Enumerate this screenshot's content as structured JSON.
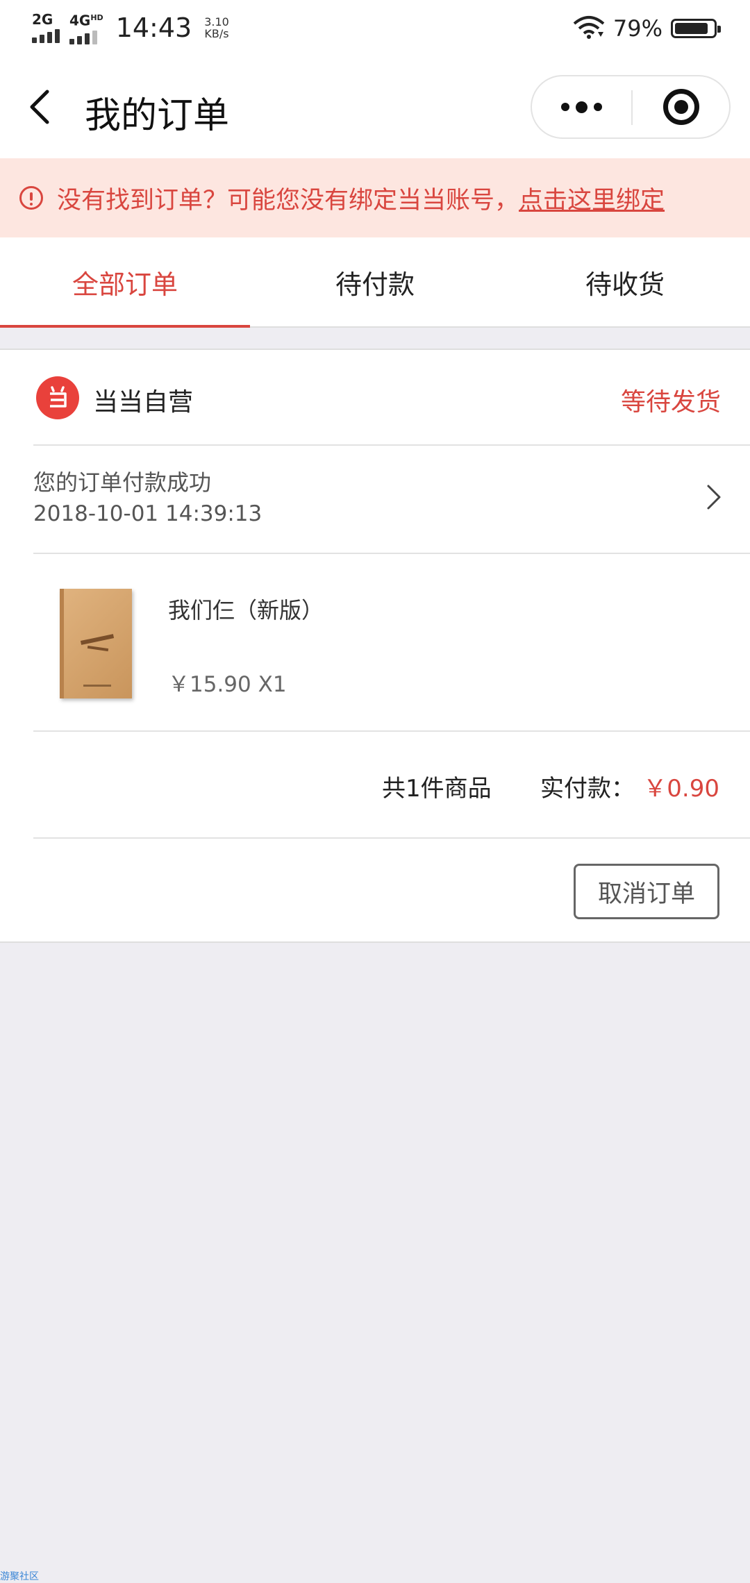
{
  "status_bar": {
    "network_1": "2G",
    "network_2": "4G",
    "network_2_sup": "HD",
    "time": "14:43",
    "speed_value": "3.10",
    "speed_unit": "KB/s",
    "battery_percent": "79%",
    "icons": [
      "signal-icon",
      "wifi-icon",
      "battery-icon"
    ]
  },
  "nav": {
    "title": "我的订单",
    "back_icon": "chevron-left-icon",
    "more_icon": "more-dots-icon",
    "close_icon": "target-close-icon"
  },
  "notice": {
    "text": "没有找到订单？可能您没有绑定当当账号，",
    "link": "点击这里绑定",
    "icon": "alert-circle-icon",
    "color": "#d9463f",
    "background": "#fde6e0"
  },
  "tabs": [
    {
      "label": "全部订单",
      "active": true
    },
    {
      "label": "待付款",
      "active": false
    },
    {
      "label": "待收货",
      "active": false
    }
  ],
  "order": {
    "shop_name": "当当自营",
    "status": "等待发货",
    "status_message": "您的订单付款成功",
    "status_time": "2018-10-01 14:39:13",
    "product": {
      "name": "我们仨（新版）",
      "price_qty": "￥15.90 X1"
    },
    "summary": {
      "count": "共1件商品",
      "paid_label": "实付款：",
      "paid_amount": "￥0.90"
    },
    "cancel_button": "取消订单"
  },
  "watermark": "游聚社区",
  "accent_color": "#d9463f"
}
